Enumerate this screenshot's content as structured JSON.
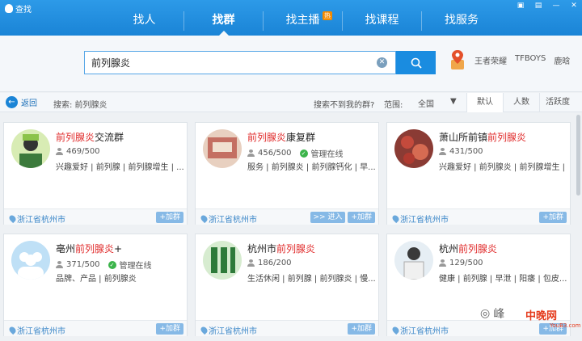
{
  "app": {
    "title": "查找",
    "icon": "penguin-icon"
  },
  "nav": {
    "tabs": [
      {
        "label": "找人",
        "active": false
      },
      {
        "label": "找群",
        "active": true
      },
      {
        "label": "找主播",
        "active": false,
        "badge": "热"
      },
      {
        "label": "找课程",
        "active": false
      },
      {
        "label": "找服务",
        "active": false
      }
    ]
  },
  "search": {
    "value": "前列腺炎",
    "hot_words": [
      "王者荣耀",
      "TFBOYS",
      "鹿晗"
    ]
  },
  "filter": {
    "back_label": "返回",
    "search_label": "搜索: 前列腺炎",
    "not_found": "搜索不到我的群?",
    "range_label": "范围:",
    "range_value": "全国",
    "sort_tabs": [
      "默认",
      "人数",
      "活跃度"
    ],
    "active_sort": "默认"
  },
  "cards": [
    {
      "name_hl": "前列腺炎",
      "name_rest": "交流群",
      "name_prefix": "",
      "count": "469/500",
      "verified": "",
      "tags": "兴趣爱好 | 前列腺 | 前列腺增生 | ...",
      "location": "浙江省杭州市",
      "enter": "",
      "join": "+加群"
    },
    {
      "name_hl": "前列腺炎",
      "name_rest": "康复群",
      "name_prefix": "",
      "count": "456/500",
      "verified": "管理在线",
      "tags": "服务 | 前列腺炎 | 前列腺钙化 | 早...",
      "location": "浙江省杭州市",
      "enter": ">> 进入",
      "join": "+加群"
    },
    {
      "name_hl": "前列腺炎",
      "name_rest": "",
      "name_prefix": "萧山所前镇",
      "count": "431/500",
      "verified": "",
      "tags": "兴趣爱好 | 前列腺炎 | 前列腺增生 |",
      "location": "浙江省杭州市",
      "enter": "",
      "join": "+加群"
    },
    {
      "name_hl": "前列腺炎",
      "name_rest": "+",
      "name_prefix": "亳州",
      "count": "371/500",
      "verified": "管理在线",
      "tags": "品牌、产品 | 前列腺炎",
      "location": "浙江省杭州市",
      "enter": "",
      "join": "+加群"
    },
    {
      "name_hl": "前列腺炎",
      "name_rest": "",
      "name_prefix": "杭州市",
      "count": "186/200",
      "verified": "",
      "tags": "生活休闲 | 前列腺 | 前列腺炎 | 慢...",
      "location": "浙江省杭州市",
      "enter": "",
      "join": "+加群"
    },
    {
      "name_hl": "前列腺炎",
      "name_rest": "",
      "name_prefix": "杭州",
      "count": "129/500",
      "verified": "",
      "tags": "健康 | 前列腺 | 早泄 | 阳痿 | 包皮...",
      "location": "浙江省杭州市",
      "enter": "",
      "join": "+加群"
    }
  ],
  "watermark": {
    "text": "峰",
    "logo": "中晚网",
    "sub": "YouB3.com"
  },
  "colors": {
    "accent": "#1a84d6",
    "highlight": "#e02b2b",
    "verified": "#3cb44b"
  }
}
